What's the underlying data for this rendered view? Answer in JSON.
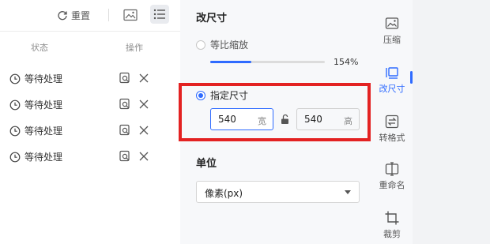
{
  "toolbar": {
    "reset_label": "重置"
  },
  "list": {
    "col_status": "状态",
    "col_action": "操作",
    "rows": [
      {
        "status": "等待处理"
      },
      {
        "status": "等待处理"
      },
      {
        "status": "等待处理"
      },
      {
        "status": "等待处理"
      }
    ]
  },
  "settings": {
    "resize_title": "改尺寸",
    "proportional_label": "等比缩放",
    "scale_percent": 154,
    "scale_text": "154%",
    "scale_fill_fraction": 0.36,
    "specified_label": "指定尺寸",
    "width_value": "540",
    "width_unit": "宽",
    "height_value": "540",
    "height_unit": "高",
    "unit_title": "单位",
    "unit_selected": "像素(px)"
  },
  "rail": {
    "items": [
      {
        "label": "压缩",
        "icon": "compress-image-icon"
      },
      {
        "label": "改尺寸",
        "icon": "resize-icon",
        "active": true
      },
      {
        "label": "转格式",
        "icon": "convert-format-icon"
      },
      {
        "label": "重命名",
        "icon": "rename-icon"
      },
      {
        "label": "裁剪",
        "icon": "crop-icon"
      }
    ]
  },
  "colors": {
    "accent": "#2f6bff",
    "highlight_box": "#e32222"
  }
}
